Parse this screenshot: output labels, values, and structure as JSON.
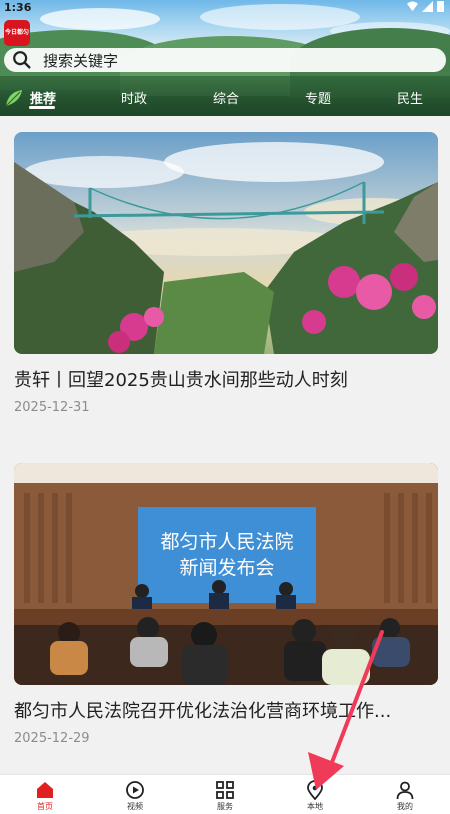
{
  "status_bar": {
    "time": "1:36"
  },
  "header": {
    "logo_text": "今日都匀",
    "search": {
      "placeholder": "搜索关键字"
    }
  },
  "tabs": [
    {
      "label": "推荐",
      "active": true
    },
    {
      "label": "时政",
      "active": false
    },
    {
      "label": "综合",
      "active": false
    },
    {
      "label": "专题",
      "active": false
    },
    {
      "label": "民生",
      "active": false
    }
  ],
  "articles": [
    {
      "title": "贵轩丨回望2025贵山贵水间那些动人时刻",
      "date": "2025-12-31"
    },
    {
      "title": "都匀市人民法院召开优化法治化营商环境工作...",
      "date": "2025-12-29",
      "screen_text": "都匀市人民法院\n新闻发布会",
      "screen_line1": "都匀市人民法院",
      "screen_line2": "新闻发布会"
    }
  ],
  "bottom_nav": [
    {
      "label": "首页",
      "icon": "home-icon",
      "active": true
    },
    {
      "label": "视频",
      "icon": "play-icon",
      "active": false
    },
    {
      "label": "服务",
      "icon": "grid-icon",
      "active": false
    },
    {
      "label": "本地",
      "icon": "location-icon",
      "active": false
    },
    {
      "label": "我的",
      "icon": "person-icon",
      "active": false
    }
  ],
  "colors": {
    "accent": "#e02020",
    "annotation_arrow": "#ef3b58"
  }
}
